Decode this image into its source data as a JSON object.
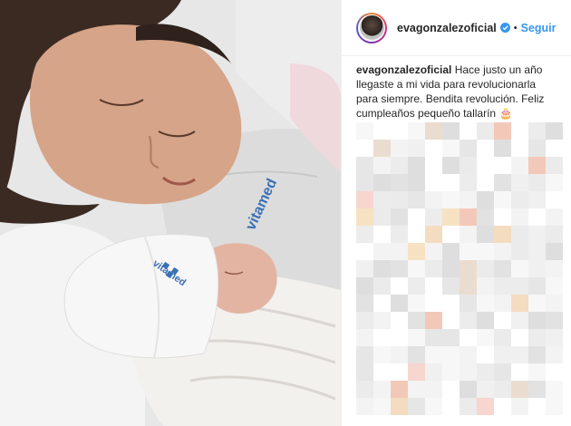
{
  "post": {
    "username": "evagonzalezoficial",
    "follow_label": "Seguir",
    "separator": "•",
    "caption_user": "evagonzalezoficial",
    "caption_text": "Hace justo un año llegaste a mi vida para revolucionarla para siempre. Bendita revolución. Feliz cumpleaños pequeño tallarín 🎂"
  },
  "photo": {
    "gown_brand": "vitamed",
    "hat_brand": "vitamed"
  },
  "colors": {
    "follow": "#3897f0",
    "verified": "#3897f0",
    "text": "#262626",
    "divider": "#efefef"
  }
}
